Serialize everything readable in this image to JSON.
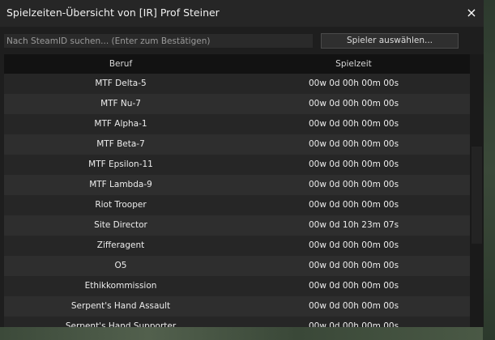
{
  "window": {
    "title": "Spielzeiten-Übersicht von [IR] Prof Steiner",
    "close_icon": "×"
  },
  "toolbar": {
    "search_placeholder": "Nach SteamID suchen... (Enter zum Bestätigen)",
    "search_value": "",
    "select_player_label": "Spieler auswählen..."
  },
  "table": {
    "columns": [
      "Beruf",
      "Spielzeit"
    ],
    "rows": [
      {
        "job": "MTF Delta-5",
        "time": "00w 0d 00h 00m 00s"
      },
      {
        "job": "MTF Nu-7",
        "time": "00w 0d 00h 00m 00s"
      },
      {
        "job": "MTF Alpha-1",
        "time": "00w 0d 00h 00m 00s"
      },
      {
        "job": "MTF Beta-7",
        "time": "00w 0d 00h 00m 00s"
      },
      {
        "job": "MTF Epsilon-11",
        "time": "00w 0d 00h 00m 00s"
      },
      {
        "job": "MTF Lambda-9",
        "time": "00w 0d 00h 00m 00s"
      },
      {
        "job": "Riot Trooper",
        "time": "00w 0d 00h 00m 00s"
      },
      {
        "job": "Site Director",
        "time": "00w 0d 10h 23m 07s"
      },
      {
        "job": "Zifferagent",
        "time": "00w 0d 00h 00m 00s"
      },
      {
        "job": "O5",
        "time": "00w 0d 00h 00m 00s"
      },
      {
        "job": "Ethikkommission",
        "time": "00w 0d 00h 00m 00s"
      },
      {
        "job": "Serpent's Hand Assault",
        "time": "00w 0d 00h 00m 00s"
      },
      {
        "job": "Serpent's Hand Supporter",
        "time": "00w 0d 00h 00m 00s"
      }
    ]
  },
  "colors": {
    "window_bg": "#1e1e1e",
    "titlebar_bg": "#262626",
    "header_bg": "#121212",
    "row_bg": "#262626",
    "row_alt_bg": "#2e2e2e"
  }
}
